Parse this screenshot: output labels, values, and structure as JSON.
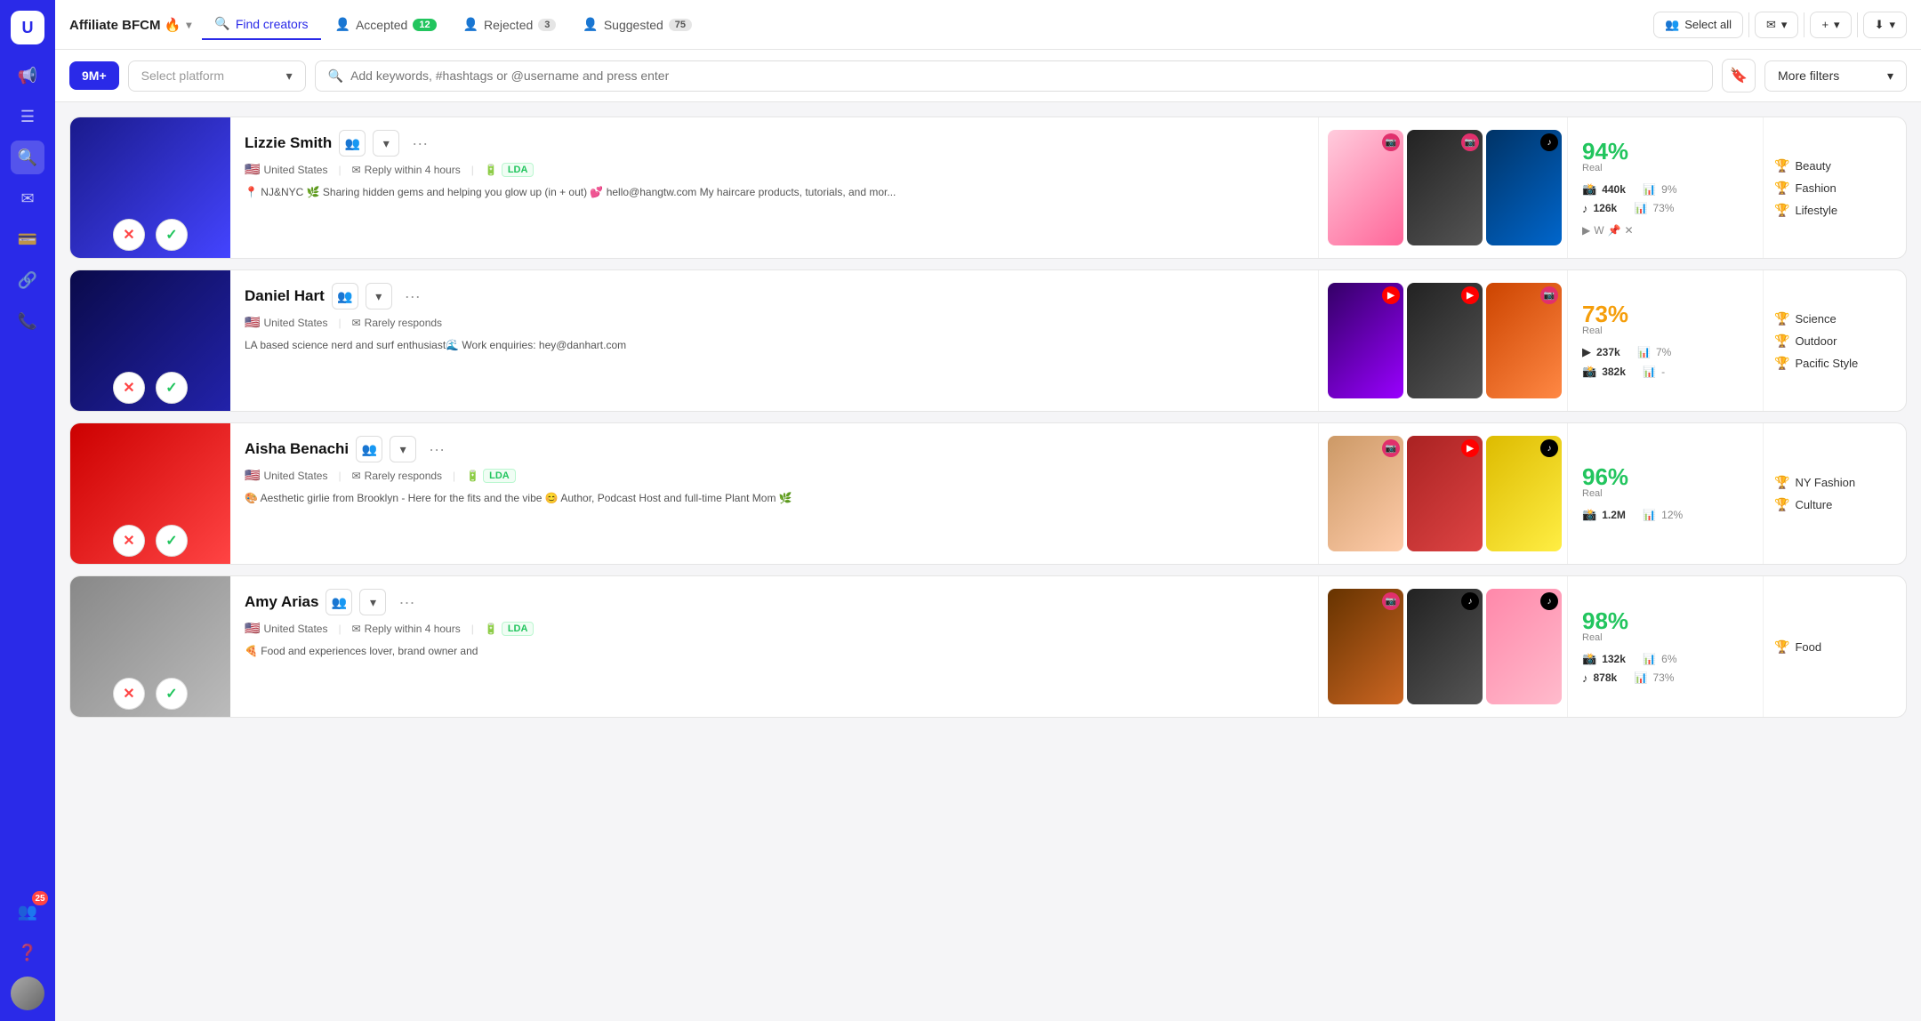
{
  "app": {
    "logo": "U",
    "campaign_title": "Affiliate BFCM 🔥",
    "campaign_chevron": "▾"
  },
  "nav": {
    "tabs": [
      {
        "id": "find",
        "label": "Find creators",
        "active": true,
        "badge": null
      },
      {
        "id": "accepted",
        "label": "Accepted",
        "active": false,
        "badge": "12",
        "badge_type": "green"
      },
      {
        "id": "rejected",
        "label": "Rejected",
        "active": false,
        "badge": "3",
        "badge_type": "gray"
      },
      {
        "id": "suggested",
        "label": "Suggested",
        "active": false,
        "badge": "75",
        "badge_type": "gray"
      }
    ],
    "select_all_label": "Select all",
    "actions": [
      "✉",
      "▾",
      "+",
      "▾",
      "⬇",
      "▾"
    ]
  },
  "filters": {
    "count_badge": "9M+",
    "platform_placeholder": "Select platform",
    "search_placeholder": "Add keywords, #hashtags or @username and press enter",
    "more_filters_label": "More filters"
  },
  "sidebar": {
    "icons": [
      "📢",
      "☰",
      "🔍",
      "✉",
      "💳",
      "🔗",
      "📞",
      "❓"
    ],
    "active_index": 2,
    "badge_count": "25"
  },
  "creators": [
    {
      "id": 1,
      "name": "Lizzie Smith",
      "country": "United States",
      "response": "Reply within 4 hours",
      "lda": "LDA",
      "bio": "📍 NJ&NYC 🌿 Sharing hidden gems and helping you glow up (in + out) 💕 hello@hangtw.com My haircare products, tutorials, and mor...",
      "photo_class": "photo-blue",
      "real_pct": "94%",
      "real_label": "Real",
      "stats": [
        {
          "platform": "ig",
          "icon": "📸",
          "followers": "440k",
          "eng_label": "📊",
          "eng": "9%"
        },
        {
          "platform": "tt",
          "icon": "♪",
          "followers": "126k",
          "eng_label": "📊",
          "eng": "73%"
        }
      ],
      "extra_socials": [
        "▶",
        "W",
        "📌",
        "✕"
      ],
      "tags": [
        "Beauty",
        "Fashion",
        "Lifestyle"
      ],
      "media": [
        {
          "class": "media-pink",
          "badge": "ig",
          "badge_class": "badge-ig"
        },
        {
          "class": "media-dark",
          "badge": "ig",
          "badge_class": "badge-ig"
        },
        {
          "class": "media-ocean",
          "badge": "tt",
          "badge_class": "badge-tt"
        }
      ]
    },
    {
      "id": 2,
      "name": "Daniel Hart",
      "country": "United States",
      "response": "Rarely responds",
      "lda": null,
      "bio": "LA based science nerd and surf enthusiast🌊 Work enquiries: hey@danhart.com",
      "photo_class": "photo-navy",
      "real_pct": "73%",
      "real_label": "real",
      "stats": [
        {
          "platform": "yt",
          "icon": "▶",
          "followers": "237k",
          "eng_label": "📊",
          "eng": "7%"
        },
        {
          "platform": "ig",
          "icon": "📸",
          "followers": "382k",
          "eng_label": "📊",
          "eng": "-"
        }
      ],
      "extra_socials": [],
      "tags": [
        "Science",
        "Outdoor",
        "Pacific Style"
      ],
      "media": [
        {
          "class": "media-purple",
          "badge": "yt",
          "badge_class": "badge-yt"
        },
        {
          "class": "media-dark",
          "badge": "yt",
          "badge_class": "badge-yt"
        },
        {
          "class": "media-orange",
          "badge": "ig",
          "badge_class": "badge-ig"
        }
      ]
    },
    {
      "id": 3,
      "name": "Aisha Benachi",
      "country": "United States",
      "response": "Rarely responds",
      "lda": "LDA",
      "bio": "🎨 Aesthetic girlie from Brooklyn - Here for the fits and the vibe 😊 Author, Podcast Host and full-time Plant Mom 🌿",
      "photo_class": "photo-red",
      "real_pct": "96%",
      "real_label": "Real",
      "stats": [
        {
          "platform": "ig",
          "icon": "📸",
          "followers": "1.2M",
          "eng_label": "📊",
          "eng": "12%"
        }
      ],
      "extra_socials": [],
      "tags": [
        "NY Fashion",
        "Culture"
      ],
      "media": [
        {
          "class": "media-tan",
          "badge": "ig",
          "badge_class": "badge-ig"
        },
        {
          "class": "media-cityred",
          "badge": "yt",
          "badge_class": "badge-yt"
        },
        {
          "class": "media-yellow",
          "badge": "tt",
          "badge_class": "badge-tt"
        }
      ]
    },
    {
      "id": 4,
      "name": "Amy Arias",
      "country": "United States",
      "response": "Reply within 4 hours",
      "lda": "LDA",
      "bio": "🍕 Food and experiences lover, brand owner and",
      "photo_class": "photo-gray",
      "real_pct": "98%",
      "real_label": "real",
      "stats": [
        {
          "platform": "ig",
          "icon": "📸",
          "followers": "132k",
          "eng_label": "📊",
          "eng": "6%"
        },
        {
          "platform": "tt",
          "icon": "♪",
          "followers": "878k",
          "eng_label": "📊",
          "eng": "73%"
        }
      ],
      "extra_socials": [],
      "tags": [
        "Food"
      ],
      "media": [
        {
          "class": "media-coffee",
          "badge": "ig",
          "badge_class": "badge-ig"
        },
        {
          "class": "media-dark",
          "badge": "tt",
          "badge_class": "badge-tt"
        },
        {
          "class": "media-flower",
          "badge": "tt",
          "badge_class": "badge-tt"
        }
      ]
    }
  ]
}
